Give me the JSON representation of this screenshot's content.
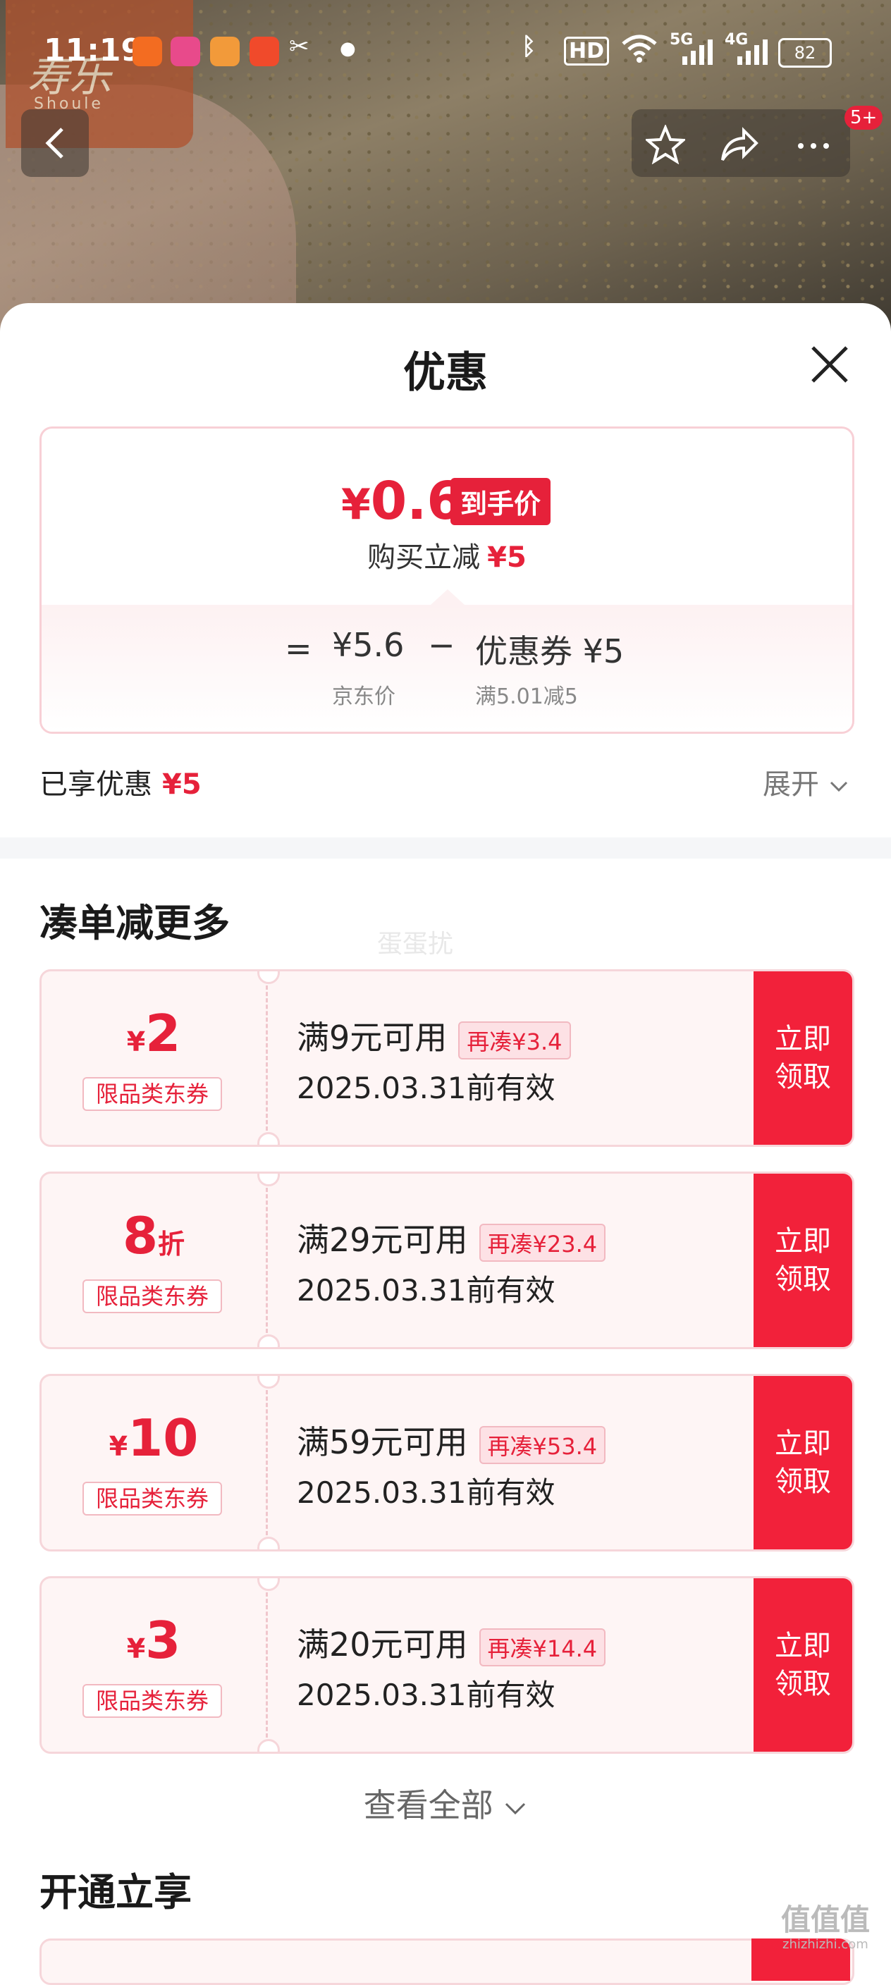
{
  "status_bar": {
    "time": "11:19",
    "network_1": "5G",
    "network_2": "4G",
    "hd": "HD",
    "battery": "82"
  },
  "hero": {
    "logo_text": "寿乐",
    "logo_sub": "Shoule",
    "badge_count": "5+"
  },
  "sheet": {
    "title": "优惠",
    "price_card": {
      "final_price_symbol": "¥",
      "final_price": "0.6",
      "final_tag": "到手价",
      "reduce_label": "购买立减",
      "reduce_value": "¥5",
      "equals": "=",
      "jd_price": "¥5.6",
      "jd_label": "京东价",
      "minus": "−",
      "coupon_value": "优惠券 ¥5",
      "coupon_rule": "满5.01减5"
    },
    "enjoyed_label": "已享优惠",
    "enjoyed_value": "¥5",
    "expand_label": "展开"
  },
  "section_more": {
    "title": "凑单减更多",
    "coupons": [
      {
        "symbol": "¥",
        "amount": "2",
        "suffix": "",
        "type": "限品类东券",
        "condition": "满9元可用",
        "diff": "再凑¥3.4",
        "date": "2025.03.31前有效",
        "button": "立即\n领取"
      },
      {
        "symbol": "",
        "amount": "8",
        "suffix": "折",
        "type": "限品类东券",
        "condition": "满29元可用",
        "diff": "再凑¥23.4",
        "date": "2025.03.31前有效",
        "button": "立即\n领取"
      },
      {
        "symbol": "¥",
        "amount": "10",
        "suffix": "",
        "type": "限品类东券",
        "condition": "满59元可用",
        "diff": "再凑¥53.4",
        "date": "2025.03.31前有效",
        "button": "立即\n领取"
      },
      {
        "symbol": "¥",
        "amount": "3",
        "suffix": "",
        "type": "限品类东券",
        "condition": "满20元可用",
        "diff": "再凑¥14.4",
        "date": "2025.03.31前有效",
        "button": "立即\n领取"
      }
    ],
    "view_all": "查看全部"
  },
  "section_open": {
    "title": "开通立享"
  },
  "overlay": {
    "watermark": "蛋蛋扰",
    "corner_mark": "值值值",
    "corner_url": "zhizhizhi.com"
  },
  "colors": {
    "accent": "#e6213a",
    "coupon_bg": "#fef5f5",
    "coupon_border": "#f6d6da"
  }
}
